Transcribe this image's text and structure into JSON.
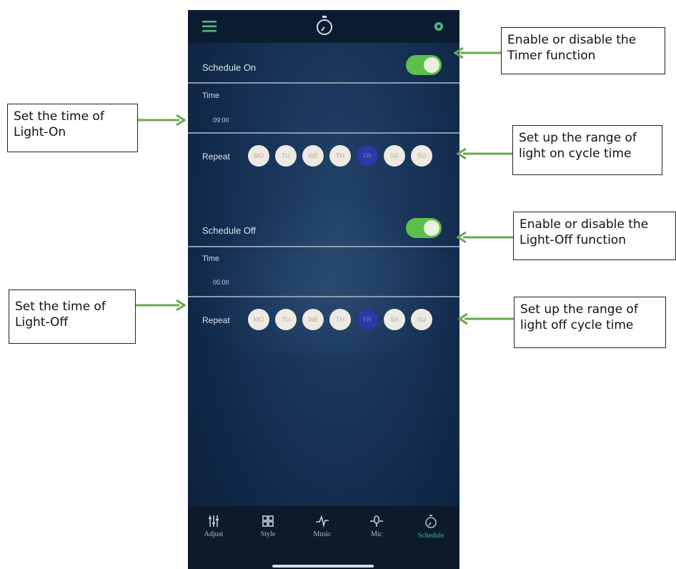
{
  "topbar": {
    "menu_icon": "menu-icon",
    "timer_icon": "timer-icon",
    "settings_icon": "gear-icon"
  },
  "schedule_on": {
    "label": "Schedule On",
    "toggle_on": true,
    "time_label": "Time",
    "time_value": "09:00",
    "repeat_label": "Repeat",
    "days": [
      {
        "label": "MO",
        "selected": false
      },
      {
        "label": "TU",
        "selected": false
      },
      {
        "label": "WE",
        "selected": false
      },
      {
        "label": "TH",
        "selected": false
      },
      {
        "label": "FR",
        "selected": true
      },
      {
        "label": "SA",
        "selected": false
      },
      {
        "label": "SU",
        "selected": false
      }
    ]
  },
  "schedule_off": {
    "label": "Schedule Off",
    "toggle_on": true,
    "time_label": "Time",
    "time_value": "05:00",
    "repeat_label": "Repeat",
    "days": [
      {
        "label": "MO",
        "selected": false
      },
      {
        "label": "TU",
        "selected": false
      },
      {
        "label": "WE",
        "selected": false
      },
      {
        "label": "TH",
        "selected": false
      },
      {
        "label": "FR",
        "selected": true
      },
      {
        "label": "SA",
        "selected": false
      },
      {
        "label": "SU",
        "selected": false
      }
    ]
  },
  "tabs": [
    {
      "label": "Adjust",
      "icon": "sliders-icon",
      "active": false
    },
    {
      "label": "Style",
      "icon": "grid-icon",
      "active": false
    },
    {
      "label": "Music",
      "icon": "music-wave-icon",
      "active": false
    },
    {
      "label": "Mic",
      "icon": "microphone-icon",
      "active": false
    },
    {
      "label": "Schedule",
      "icon": "timer-icon",
      "active": true
    }
  ],
  "annotations": {
    "timer_function": "Enable or disable the Timer function",
    "light_on_time": "Set the time of Light-On",
    "light_on_cycle": "Set up the range of light on cycle time",
    "light_off_function": "Enable or disable the Light-Off function",
    "light_off_time": "Set the time of Light-Off",
    "light_off_cycle": "Set up the range of light off cycle time"
  },
  "colors": {
    "accent_green": "#5cc04a",
    "arrow_green": "#6aa84f",
    "active_tab": "#35b88f",
    "selected_day": "#2b39a6",
    "background": "#173357"
  }
}
